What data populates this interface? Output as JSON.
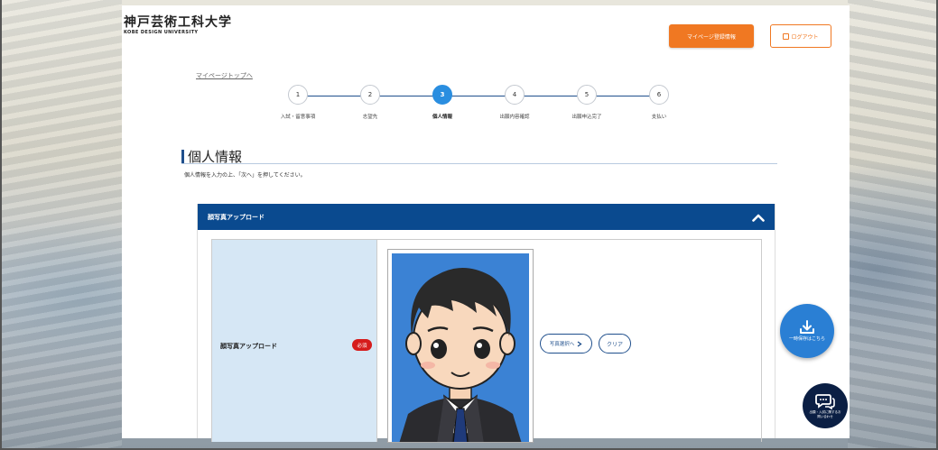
{
  "header": {
    "logo_jp": "神戸芸術工科大学",
    "logo_en": "KOBE DESIGN UNIVERSITY",
    "mypage_button": "マイページ登録情報",
    "logout_button": "ログアウト"
  },
  "breadcrumb": "マイページトップへ",
  "steps": [
    {
      "number": "1",
      "label": "入試・留意事項"
    },
    {
      "number": "2",
      "label": "志望先"
    },
    {
      "number": "3",
      "label": "個人情報",
      "active": true
    },
    {
      "number": "4",
      "label": "出願内容確認"
    },
    {
      "number": "5",
      "label": "出願申込完了"
    },
    {
      "number": "6",
      "label": "支払い"
    }
  ],
  "section": {
    "title": "個人情報",
    "instruction": "個人情報を入力の上、「次へ」を押してください。"
  },
  "photo_upload": {
    "header": "顔写真アップロード",
    "field_label": "顔写真アップロード",
    "required_badge": "必須",
    "select_button": "写真選択へ",
    "clear_button": "クリア"
  },
  "floating": {
    "save_label": "一時保存はこちら",
    "chat_label": "出願・入試に関するお問い合わせ"
  },
  "colors": {
    "primary": "#0a4a8f",
    "accent": "#f07822",
    "active_step": "#2a8ee0",
    "required": "#d61c1c",
    "label_bg": "#d6e7f5"
  }
}
